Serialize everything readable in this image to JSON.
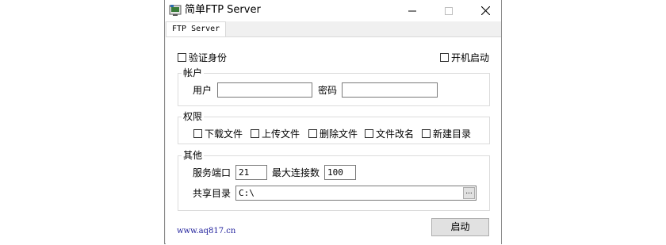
{
  "window": {
    "title": "简单FTP Server",
    "controls": {
      "minimize": "—",
      "maximize": "☐",
      "close": "✕"
    }
  },
  "tabs": [
    {
      "label": "FTP Server",
      "active": true
    }
  ],
  "options": {
    "verify_identity": {
      "label": "验证身份",
      "checked": false
    },
    "autostart": {
      "label": "开机启动",
      "checked": false
    }
  },
  "account": {
    "title": "帐户",
    "user_label": "用户",
    "user_value": "",
    "password_label": "密码",
    "password_value": ""
  },
  "permissions": {
    "title": "权限",
    "items": [
      {
        "label": "下载文件",
        "checked": false
      },
      {
        "label": "上传文件",
        "checked": false
      },
      {
        "label": "删除文件",
        "checked": false
      },
      {
        "label": "文件改名",
        "checked": false
      },
      {
        "label": "新建目录",
        "checked": false
      }
    ]
  },
  "other": {
    "title": "其他",
    "port_label": "服务端口",
    "port_value": "21",
    "maxconn_label": "最大连接数",
    "maxconn_value": "100",
    "dir_label": "共享目录",
    "dir_value": "C:\\",
    "browse_label": "..."
  },
  "footer": {
    "link": "www.aq817.cn",
    "start_label": "启动"
  },
  "colors": {
    "link": "#1c1c9a",
    "panel": "#ffffff",
    "chrome": "#f0f0f0"
  }
}
